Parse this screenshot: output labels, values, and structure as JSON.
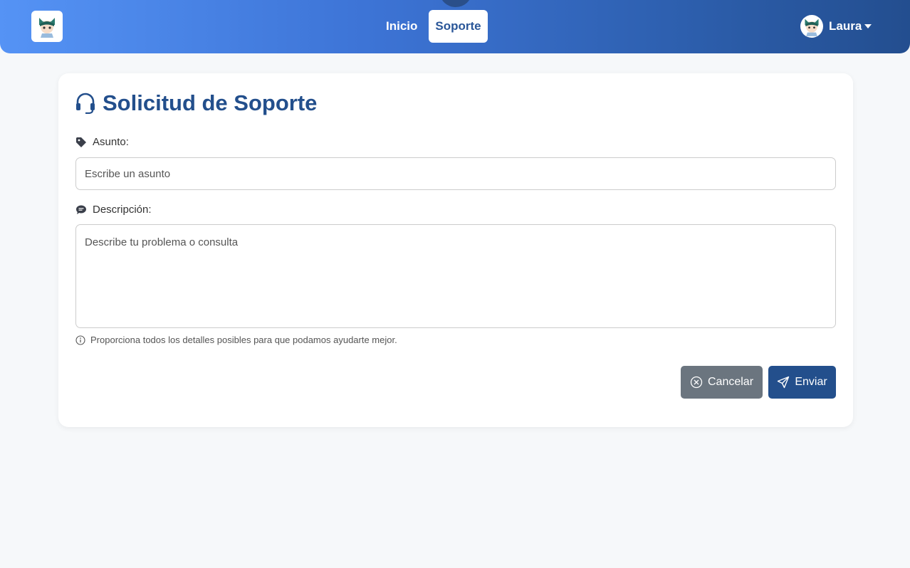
{
  "navbar": {
    "logo_icon": "girl-avatar-icon",
    "links": [
      {
        "label": "Inicio",
        "active": false
      },
      {
        "label": "Soporte",
        "active": true
      }
    ],
    "user": {
      "name": "Laura",
      "avatar_icon": "girl-avatar-icon"
    }
  },
  "form": {
    "title": "Solicitud de Soporte",
    "title_icon": "headset-icon",
    "subject": {
      "label": "Asunto:",
      "icon": "tag-icon",
      "placeholder": "Escribe un asunto"
    },
    "description": {
      "label": "Descripción:",
      "icon": "chat-icon",
      "placeholder": "Describe tu problema o consulta"
    },
    "hint": {
      "icon": "info-icon",
      "text": "Proporciona todos los detalles posibles para que podamos ayudarte mejor."
    },
    "cancel_label": "Cancelar",
    "send_label": "Enviar"
  },
  "colors": {
    "primary": "#234f8c",
    "nav_gradient_start": "#5593f5",
    "nav_gradient_end": "#234e8f",
    "cancel": "#6b757f",
    "page_background": "#f6f8fa"
  }
}
